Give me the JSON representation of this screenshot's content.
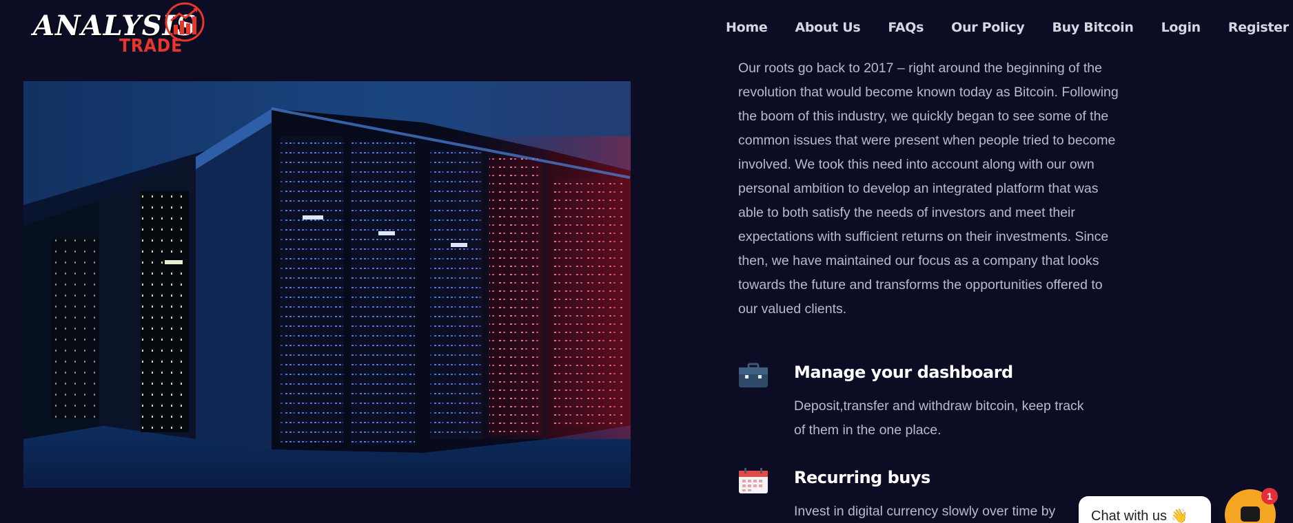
{
  "header": {
    "logo_text": "ANALYSIS",
    "logo_subtext": "TRADE",
    "nav": [
      {
        "label": "Home"
      },
      {
        "label": "About Us"
      },
      {
        "label": "FAQs"
      },
      {
        "label": "Our Policy"
      },
      {
        "label": "Buy Bitcoin"
      },
      {
        "label": "Login"
      },
      {
        "label": "Register"
      }
    ]
  },
  "about": {
    "paragraph_lines": [
      "Our roots go back to 2017 – right around the beginning of the",
      "revolution that would become known today as Bitcoin. Following",
      "the boom of this industry, we quickly began to see some of the",
      "common issues that were present when people tried to become",
      "involved. We took this need into account along with our own",
      "personal ambition to develop an integrated platform that was",
      "able to both satisfy the needs of investors and meet their",
      "expectations with sufficient returns on their investments. Since",
      "then, we have maintained our focus as a company that looks",
      "towards the future and transforms the opportunities offered to",
      "our valued clients."
    ]
  },
  "features": [
    {
      "icon": "briefcase-icon",
      "title": "Manage your dashboard",
      "desc_lines": [
        "Deposit,transfer and withdraw bitcoin, keep track",
        "of them in the one place."
      ]
    },
    {
      "icon": "calendar-icon",
      "title": "Recurring buys",
      "desc_lines": [
        "Invest in digital currency slowly over time by",
        ""
      ]
    }
  ],
  "chat": {
    "label": "Chat with us",
    "emoji": "👋",
    "badge_count": "1"
  },
  "colors": {
    "background": "#0c0c24",
    "brand_red": "#e8362c",
    "chat_orange": "#f4a623",
    "badge_red": "#e52d3c"
  }
}
